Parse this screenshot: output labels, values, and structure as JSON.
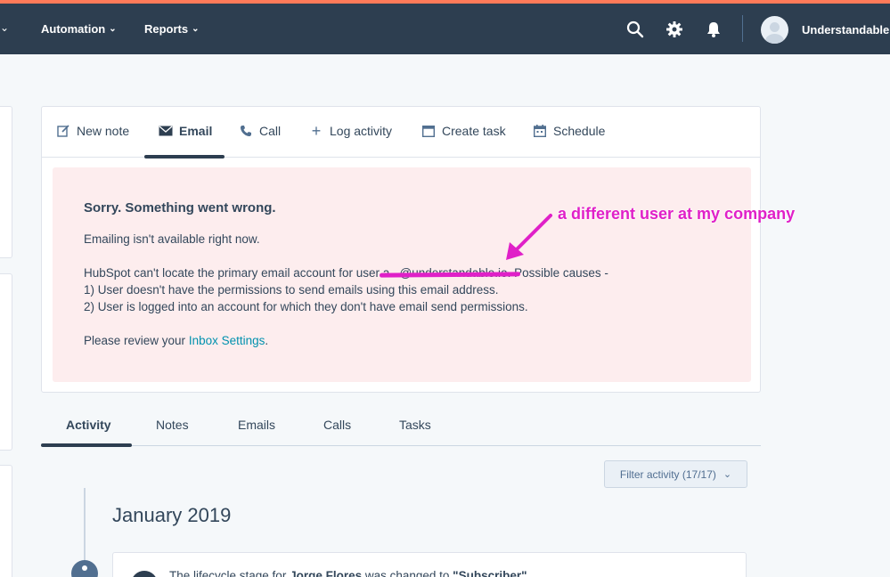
{
  "topnav": {
    "items": [
      {
        "label": "Automation"
      },
      {
        "label": "Reports"
      }
    ],
    "account_name": "Understandable."
  },
  "composer": {
    "tabs": [
      {
        "label": "New note",
        "icon": "edit-icon"
      },
      {
        "label": "Email",
        "icon": "envelope-icon"
      },
      {
        "label": "Call",
        "icon": "phone-icon"
      },
      {
        "label": "Log activity",
        "icon": "plus-icon"
      },
      {
        "label": "Create task",
        "icon": "task-icon"
      },
      {
        "label": "Schedule",
        "icon": "calendar-icon"
      }
    ],
    "active_tab": "Email",
    "error": {
      "title": "Sorry. Something went wrong.",
      "line1": "Emailing isn't available right now.",
      "line2_before": "HubSpot can't locate the primary email account for user ",
      "line2_email": "a...@understandable.io",
      "line2_after": ". Possible causes -",
      "line3": "1) User doesn't have the permissions to send emails using this email address.",
      "line4": "2) User is logged into an account for which they don't have email send permissions.",
      "line5_before": "Please review your ",
      "line5_link": "Inbox Settings",
      "line5_after": "."
    }
  },
  "annotation": {
    "text": "a different user at my company",
    "color": "#e020c8"
  },
  "activity": {
    "tabs": [
      {
        "label": "Activity"
      },
      {
        "label": "Notes"
      },
      {
        "label": "Emails"
      },
      {
        "label": "Calls"
      },
      {
        "label": "Tasks"
      }
    ],
    "active_tab": "Activity",
    "filter_label": "Filter activity (17/17)",
    "month": "January 2019",
    "feed": {
      "before": "The lifecycle stage for ",
      "name": "Jorge Flores",
      "middle": " was changed to ",
      "stage": "\"Subscriber\""
    }
  },
  "colors": {
    "nav_bg": "#2d3e50",
    "accent": "#ff7a59",
    "error_bg": "#fdedee",
    "link": "#0091ae"
  }
}
